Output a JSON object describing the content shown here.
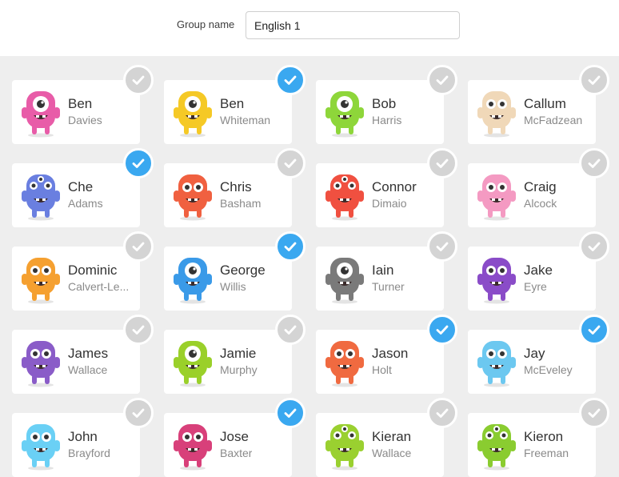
{
  "group": {
    "label": "Group name",
    "value": "English 1"
  },
  "students": [
    {
      "first": "Ben",
      "last": "Davies",
      "selected": false,
      "color": "#e85ca8",
      "eye": "cyclops"
    },
    {
      "first": "Ben",
      "last": "Whiteman",
      "selected": true,
      "color": "#f5c926",
      "eye": "cyclops"
    },
    {
      "first": "Bob",
      "last": "Harris",
      "selected": false,
      "color": "#8ed63a",
      "eye": "cyclops"
    },
    {
      "first": "Callum",
      "last": "McFadzean",
      "selected": false,
      "color": "#f0d8b8",
      "eye": "two"
    },
    {
      "first": "Che",
      "last": "Adams",
      "selected": true,
      "color": "#6a7fe0",
      "eye": "multi"
    },
    {
      "first": "Chris",
      "last": "Basham",
      "selected": false,
      "color": "#f06040",
      "eye": "two"
    },
    {
      "first": "Connor",
      "last": "Dimaio",
      "selected": false,
      "color": "#f05040",
      "eye": "multi"
    },
    {
      "first": "Craig",
      "last": "Alcock",
      "selected": false,
      "color": "#f49ac2",
      "eye": "two"
    },
    {
      "first": "Dominic",
      "last": "Calvert-Le...",
      "selected": false,
      "color": "#f5a030",
      "eye": "two"
    },
    {
      "first": "George",
      "last": "Willis",
      "selected": true,
      "color": "#3a9ae8",
      "eye": "cyclops"
    },
    {
      "first": "Iain",
      "last": "Turner",
      "selected": false,
      "color": "#7a7a7a",
      "eye": "cyclops"
    },
    {
      "first": "Jake",
      "last": "Eyre",
      "selected": false,
      "color": "#8a4cc8",
      "eye": "two"
    },
    {
      "first": "James",
      "last": "Wallace",
      "selected": false,
      "color": "#8a5cc8",
      "eye": "two"
    },
    {
      "first": "Jamie",
      "last": "Murphy",
      "selected": false,
      "color": "#9ad02a",
      "eye": "cyclops"
    },
    {
      "first": "Jason",
      "last": "Holt",
      "selected": true,
      "color": "#f06a40",
      "eye": "two"
    },
    {
      "first": "Jay",
      "last": "McEveley",
      "selected": true,
      "color": "#6cc8f0",
      "eye": "two"
    },
    {
      "first": "John",
      "last": "Brayford",
      "selected": false,
      "color": "#6ad0f5",
      "eye": "two"
    },
    {
      "first": "Jose",
      "last": "Baxter",
      "selected": true,
      "color": "#d8407a",
      "eye": "two"
    },
    {
      "first": "Kieran",
      "last": "Wallace",
      "selected": false,
      "color": "#9ad030",
      "eye": "multi"
    },
    {
      "first": "Kieron",
      "last": "Freeman",
      "selected": false,
      "color": "#8acc30",
      "eye": "multi"
    }
  ]
}
